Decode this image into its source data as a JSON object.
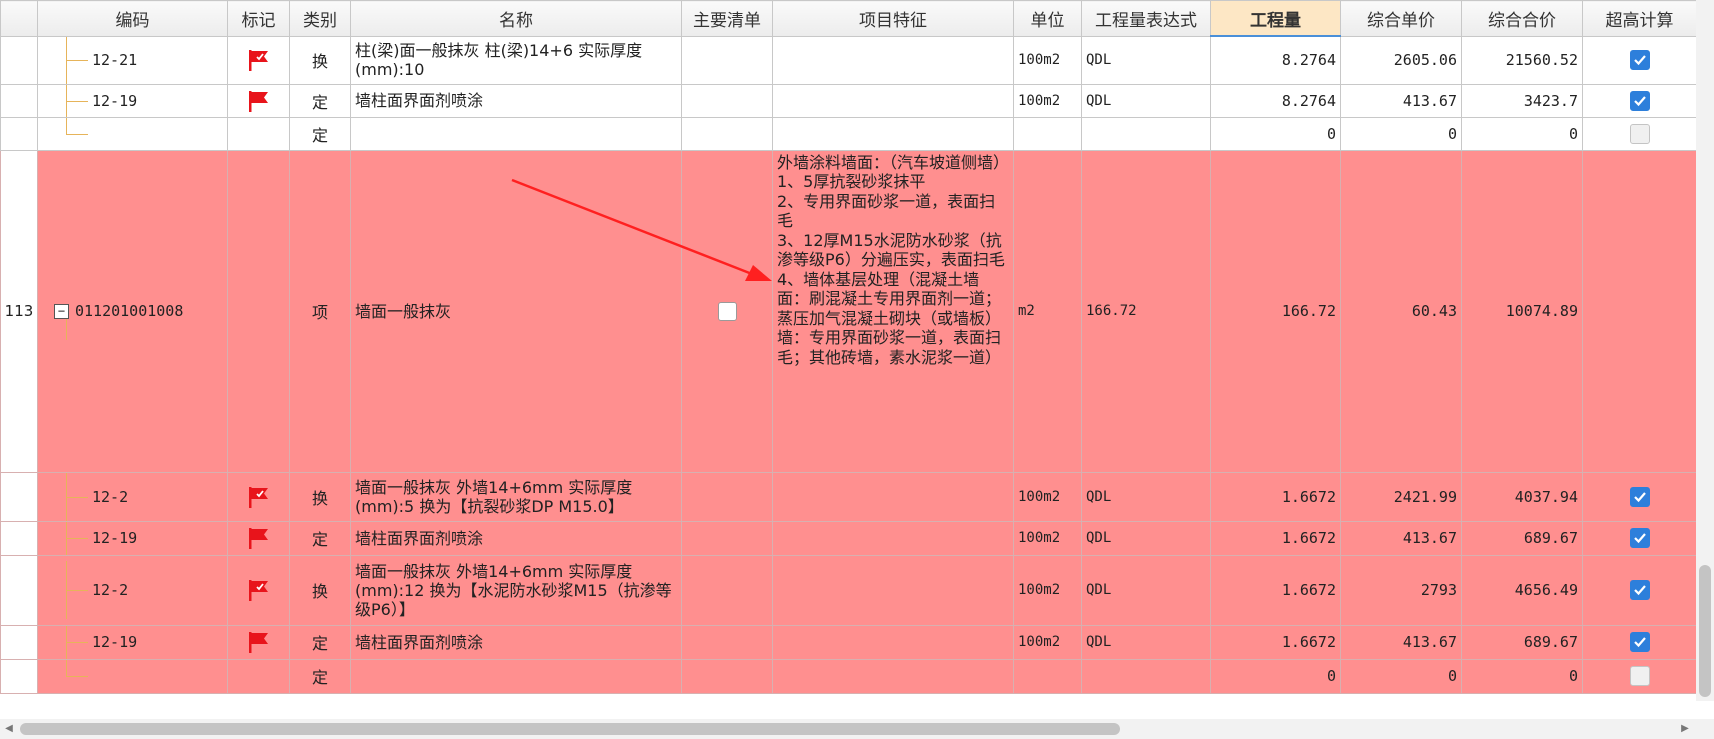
{
  "columns": {
    "code": "编码",
    "mark": "标记",
    "category": "类别",
    "name": "名称",
    "main_list": "主要清单",
    "feature": "项目特征",
    "unit": "单位",
    "expr": "工程量表达式",
    "quantity": "工程量",
    "unit_price": "综合单价",
    "total_price": "综合合价",
    "super_high": "超高计算"
  },
  "rows": [
    {
      "rownum": "",
      "code": "12-21",
      "category": "换",
      "name": "柱(梁)面一般抹灰 柱(梁)14+6  实际厚度(mm):10",
      "unit": "100m2",
      "expr": "QDL",
      "quantity": "8.2764",
      "unit_price": "2605.06",
      "total_price": "21560.52"
    },
    {
      "rownum": "",
      "code": "12-19",
      "category": "定",
      "name": "墙柱面界面剂喷涂",
      "unit": "100m2",
      "expr": "QDL",
      "quantity": "8.2764",
      "unit_price": "413.67",
      "total_price": "3423.7"
    },
    {
      "rownum": "",
      "code": "",
      "category": "定",
      "name": "",
      "unit": "",
      "expr": "",
      "quantity": "0",
      "unit_price": "0",
      "total_price": "0"
    },
    {
      "rownum": "113",
      "code": "011201001008",
      "category": "项",
      "name": "墙面一般抹灰",
      "feature": "外墙涂料墙面：（汽车坡道侧墙）\n1、5厚抗裂砂浆抹平\n2、专用界面砂浆一道，表面扫毛\n3、12厚M15水泥防水砂浆（抗渗等级P6）分遍压实，表面扫毛\n4、墙体基层处理（混凝土墙面：刷混凝土专用界面剂一道；蒸压加气混凝土砌块（或墙板）墙：专用界面砂浆一道，表面扫毛；其他砖墙，素水泥浆一道）",
      "unit": "m2",
      "expr": "166.72",
      "quantity": "166.72",
      "unit_price": "60.43",
      "total_price": "10074.89"
    },
    {
      "rownum": "",
      "code": "12-2",
      "category": "换",
      "name": "墙面一般抹灰 外墙14+6mm  实际厚度(mm):5  换为【抗裂砂浆DP M15.0】",
      "unit": "100m2",
      "expr": "QDL",
      "quantity": "1.6672",
      "unit_price": "2421.99",
      "total_price": "4037.94"
    },
    {
      "rownum": "",
      "code": "12-19",
      "category": "定",
      "name": "墙柱面界面剂喷涂",
      "unit": "100m2",
      "expr": "QDL",
      "quantity": "1.6672",
      "unit_price": "413.67",
      "total_price": "689.67"
    },
    {
      "rownum": "",
      "code": "12-2",
      "category": "换",
      "name": "墙面一般抹灰 外墙14+6mm  实际厚度(mm):12  换为【水泥防水砂浆M15（抗渗等级P6）】",
      "unit": "100m2",
      "expr": "QDL",
      "quantity": "1.6672",
      "unit_price": "2793",
      "total_price": "4656.49"
    },
    {
      "rownum": "",
      "code": "12-19",
      "category": "定",
      "name": "墙柱面界面剂喷涂",
      "unit": "100m2",
      "expr": "QDL",
      "quantity": "1.6672",
      "unit_price": "413.67",
      "total_price": "689.67"
    },
    {
      "rownum": "",
      "code": "",
      "category": "定",
      "name": "",
      "unit": "",
      "expr": "",
      "quantity": "0",
      "unit_price": "0",
      "total_price": "0"
    }
  ],
  "colors": {
    "highlight_row": "#ff8f8f",
    "checkbox_on": "#2d7fdb",
    "flag": "#e8141b",
    "annotation_arrow": "#ff2020",
    "tree_line": "#e6b45a"
  },
  "icons": {
    "mark": "red-flag-icon",
    "check": "checkbox-checked-icon",
    "expander": "collapse-minus-icon"
  },
  "expander_symbol": "−",
  "scroll_arrows": {
    "left": "◀",
    "right": "▶"
  }
}
